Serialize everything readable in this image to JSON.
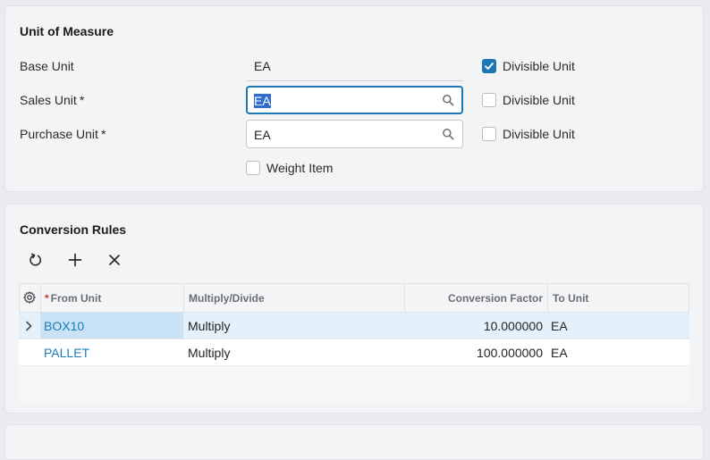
{
  "unit_of_measure": {
    "title": "Unit of Measure",
    "base_unit": {
      "label": "Base Unit",
      "value": "EA",
      "divisible_label": "Divisible Unit",
      "divisible_checked": true
    },
    "sales_unit": {
      "label": "Sales Unit",
      "required": "*",
      "value": "EA",
      "divisible_label": "Divisible Unit",
      "divisible_checked": false
    },
    "purchase_unit": {
      "label": "Purchase Unit",
      "required": "*",
      "value": "EA",
      "divisible_label": "Divisible Unit",
      "divisible_checked": false
    },
    "weight_item": {
      "label": "Weight Item",
      "checked": false
    }
  },
  "conversion_rules": {
    "title": "Conversion Rules",
    "toolbar": {
      "refresh_icon": "refresh-icon",
      "add_icon": "plus-icon",
      "delete_icon": "close-icon"
    },
    "columns": {
      "settings_icon": "gear-icon",
      "from_unit": "From Unit",
      "from_unit_required": "*",
      "multiply_divide": "Multiply/Divide",
      "conversion_factor": "Conversion Factor",
      "to_unit": "To Unit"
    },
    "rows": [
      {
        "from_unit": "BOX10",
        "multiply_divide": "Multiply",
        "conversion_factor": "10.000000",
        "to_unit": "EA"
      },
      {
        "from_unit": "PALLET",
        "multiply_divide": "Multiply",
        "conversion_factor": "100.000000",
        "to_unit": "EA"
      }
    ]
  },
  "colors": {
    "accent": "#1d77b5",
    "link": "#1a7db8",
    "required": "#d0362f",
    "selected_row": "#e5f1fa"
  }
}
